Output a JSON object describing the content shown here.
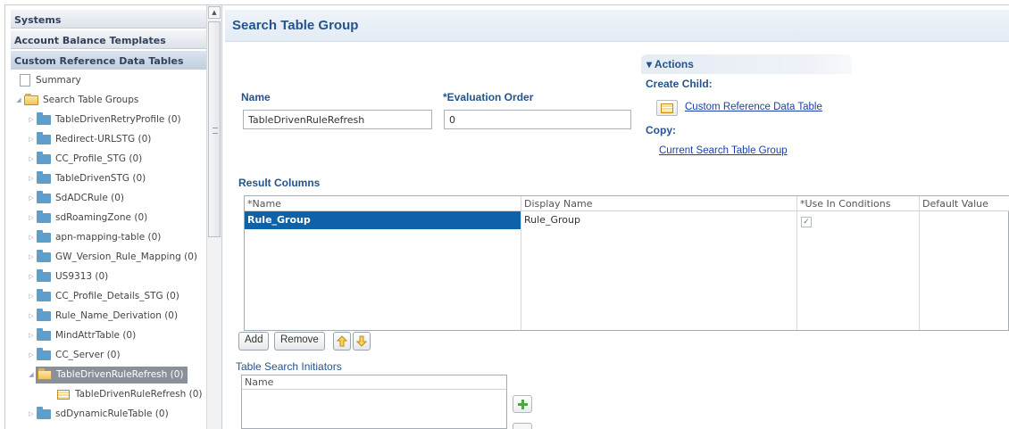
{
  "sidebar": {
    "accordion": [
      "Systems",
      "Account Balance Templates",
      "Custom Reference Data Tables"
    ],
    "summary": "Summary",
    "group_root": "Search Table Groups",
    "items": [
      "TableDrivenRetryProfile (0)",
      "Redirect-URLSTG (0)",
      "CC_Profile_STG (0)",
      "TableDrivenSTG (0)",
      "SdADCRule (0)",
      "sdRoamingZone (0)",
      "apn-mapping-table (0)",
      "GW_Version_Rule_Mapping (0)",
      "US9313 (0)",
      "CC_Profile_Details_STG (0)",
      "Rule_Name_Derivation (0)",
      "MindAttrTable (0)",
      "CC_Server (0)",
      "TableDrivenRuleRefresh (0)",
      "TableDrivenRuleRefresh (0)",
      "sdDynamicRuleTable (0)"
    ]
  },
  "main": {
    "title": "Search Table Group",
    "name_label": "Name",
    "name_value": "TableDrivenRuleRefresh",
    "eval_label": "*Evaluation Order",
    "eval_value": "0",
    "actions": {
      "header": "▾ Actions",
      "create_child_label": "Create Child:",
      "create_child_link": "Custom Reference Data Table",
      "copy_label": "Copy:",
      "copy_link": "Current Search Table Group"
    },
    "result_columns": {
      "label": "Result Columns",
      "headers": [
        "*Name",
        "Display Name",
        "*Use In Conditions",
        "Default Value"
      ],
      "rows": [
        {
          "name": "Rule_Group",
          "display_name": "Rule_Group",
          "use_in_conditions": "✓",
          "default_value": ""
        }
      ]
    },
    "buttons": {
      "add": "Add",
      "remove": "Remove"
    },
    "initiators": {
      "label": "Table Search Initiators",
      "header": "Name"
    }
  },
  "colors": {
    "accent": "#24548e",
    "selected_row": "#0f62a8",
    "link": "#1c3faa"
  }
}
